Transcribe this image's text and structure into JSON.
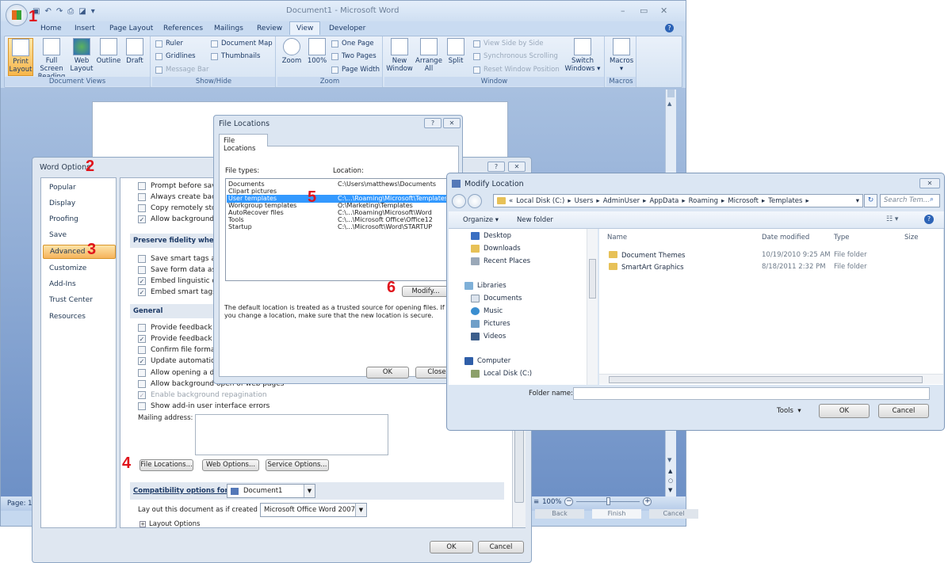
{
  "word": {
    "title": "Document1 - Microsoft Word",
    "quick_access": [
      "save-icon",
      "undo-icon",
      "redo-icon",
      "print-icon",
      "print-preview-icon",
      "customize-icon"
    ],
    "tabs": [
      "Home",
      "Insert",
      "Page Layout",
      "References",
      "Mailings",
      "Review",
      "View",
      "Developer"
    ],
    "active_tab": "View",
    "ribbon": {
      "document_views": {
        "label": "Document Views",
        "buttons": [
          "Print Layout",
          "Full Screen Reading",
          "Web Layout",
          "Outline",
          "Draft"
        ],
        "selected": "Print Layout"
      },
      "show_hide": {
        "label": "Show/Hide",
        "items": [
          {
            "label": "Ruler",
            "checked": false
          },
          {
            "label": "Gridlines",
            "checked": false
          },
          {
            "label": "Message Bar",
            "checked": false,
            "disabled": true
          },
          {
            "label": "Document Map",
            "checked": false
          },
          {
            "label": "Thumbnails",
            "checked": false
          }
        ]
      },
      "zoom": {
        "label": "Zoom",
        "buttons": [
          "Zoom",
          "100%"
        ],
        "small": [
          "One Page",
          "Two Pages",
          "Page Width"
        ]
      },
      "window": {
        "label": "Window",
        "buttons": [
          "New Window",
          "Arrange All",
          "Split"
        ],
        "small": [
          "View Side by Side",
          "Synchronous Scrolling",
          "Reset Window Position"
        ],
        "switch": "Switch Windows"
      },
      "macros": {
        "label": "Macros",
        "button": "Macros"
      }
    },
    "status": {
      "page": "Page: 1",
      "zoom": "100%"
    },
    "wizard_buttons": [
      "Back",
      "Finish",
      "Cancel"
    ]
  },
  "word_options": {
    "title": "Word Options",
    "sidebar": [
      "Popular",
      "Display",
      "Proofing",
      "Save",
      "Advanced",
      "Customize",
      "Add-Ins",
      "Trust Center",
      "Resources"
    ],
    "selected": "Advanced",
    "save_checks": [
      {
        "label": "Prompt before saving",
        "checked": false
      },
      {
        "label": "Always create backup",
        "checked": false
      },
      {
        "label": "Copy remotely stored",
        "checked": false
      },
      {
        "label": "Allow background sa",
        "checked": true
      }
    ],
    "section_fidelity": "Preserve fidelity when sha",
    "fidelity_checks": [
      {
        "label": "Save smart tags as XM",
        "checked": false
      },
      {
        "label": "Save form data as deli",
        "checked": false
      },
      {
        "label": "Embed linguistic data",
        "checked": true
      },
      {
        "label": "Embed smart tags",
        "checked": true
      }
    ],
    "section_general": "General",
    "general_checks": [
      {
        "label": "Provide feedback with",
        "checked": false
      },
      {
        "label": "Provide feedback with",
        "checked": true
      },
      {
        "label": "Confirm file format co",
        "checked": false
      },
      {
        "label": "Update automatic link",
        "checked": true
      },
      {
        "label": "Allow opening a docu",
        "checked": false
      },
      {
        "label": "Allow background open of web pages",
        "checked": false
      },
      {
        "label": "Enable background repagination",
        "checked": true,
        "disabled": true
      },
      {
        "label": "Show add-in user interface errors",
        "checked": false
      }
    ],
    "mailing_label": "Mailing address:",
    "mailing_value": "",
    "buttons": {
      "file_locations": "File Locations...",
      "web_options": "Web Options...",
      "service_options": "Service Options..."
    },
    "compat_label": "Compatibility options for:",
    "compat_doc": "Document1",
    "layout_label": "Lay out this document as if created in:",
    "layout_value": "Microsoft Office Word 2007",
    "layout_options": "Layout Options",
    "ok": "OK",
    "cancel": "Cancel"
  },
  "file_locations": {
    "title": "File Locations",
    "tab": "File Locations",
    "col_types": "File types:",
    "col_location": "Location:",
    "rows": [
      {
        "type": "Documents",
        "location": "C:\\Users\\matthews\\Documents"
      },
      {
        "type": "Clipart pictures",
        "location": ""
      },
      {
        "type": "User templates",
        "location": "C:\\...\\Roaming\\Microsoft\\Templates"
      },
      {
        "type": "Workgroup templates",
        "location": "O:\\Marketing\\Templates"
      },
      {
        "type": "AutoRecover files",
        "location": "C:\\...\\Roaming\\Microsoft\\Word"
      },
      {
        "type": "Tools",
        "location": "C:\\...\\Microsoft Office\\Office12"
      },
      {
        "type": "Startup",
        "location": "C:\\...\\Microsoft\\Word\\STARTUP"
      }
    ],
    "selected_row": 2,
    "modify": "Modify...",
    "note": "The default location is treated as a trusted source for opening files. If you change a location, make sure that the new location is secure.",
    "ok": "OK",
    "close": "Close"
  },
  "modify_location": {
    "title": "Modify Location",
    "breadcrumb": [
      "Local Disk (C:)",
      "Users",
      "AdminUser",
      "AppData",
      "Roaming",
      "Microsoft",
      "Templates"
    ],
    "search_placeholder": "Search Tem...",
    "organize": "Organize",
    "new_folder": "New folder",
    "nav": {
      "favorites": [
        "Desktop",
        "Downloads",
        "Recent Places"
      ],
      "libraries_label": "Libraries",
      "libraries": [
        "Documents",
        "Music",
        "Pictures",
        "Videos"
      ],
      "computer_label": "Computer",
      "computer": [
        "Local Disk (C:)"
      ]
    },
    "columns": [
      "Name",
      "Date modified",
      "Type",
      "Size"
    ],
    "files": [
      {
        "name": "Document Themes",
        "date": "10/19/2010 9:25 AM",
        "type": "File folder",
        "size": ""
      },
      {
        "name": "SmartArt Graphics",
        "date": "8/18/2011 2:32 PM",
        "type": "File folder",
        "size": ""
      }
    ],
    "folder_name_label": "Folder name:",
    "folder_name_value": "",
    "tools": "Tools",
    "ok": "OK",
    "cancel": "Cancel"
  },
  "annotations": [
    "1",
    "2",
    "3",
    "4",
    "5",
    "6"
  ],
  "colors": {
    "accent": "#f8b64a",
    "selection": "#3399ff",
    "annotation": "#e0141c"
  }
}
